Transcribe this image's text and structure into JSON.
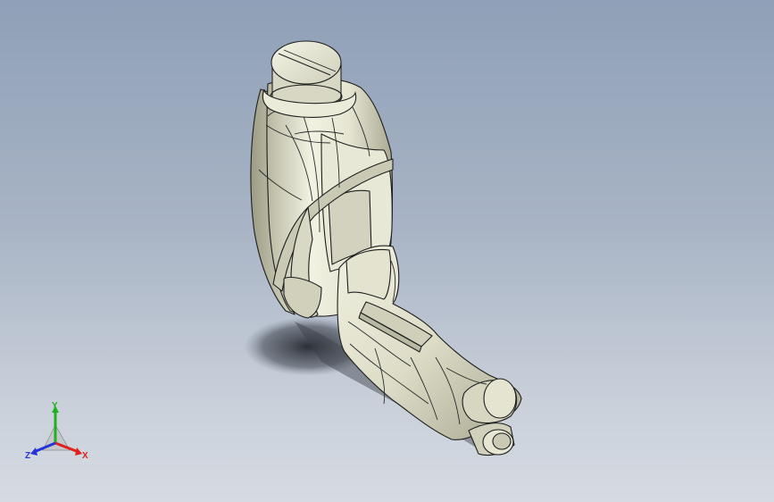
{
  "viewport": {
    "background_top": "#8fa0b7",
    "background_bottom": "#d6dbe2"
  },
  "model": {
    "body_color": "#e2e2cf",
    "edge_color": "#1e1e1e",
    "shadow_color": "#2a2e36"
  },
  "triad": {
    "x_label": "X",
    "y_label": "Y",
    "z_label": "Z",
    "x_color": "#e0201c",
    "y_color": "#1fb21f",
    "z_color": "#2434d8"
  }
}
